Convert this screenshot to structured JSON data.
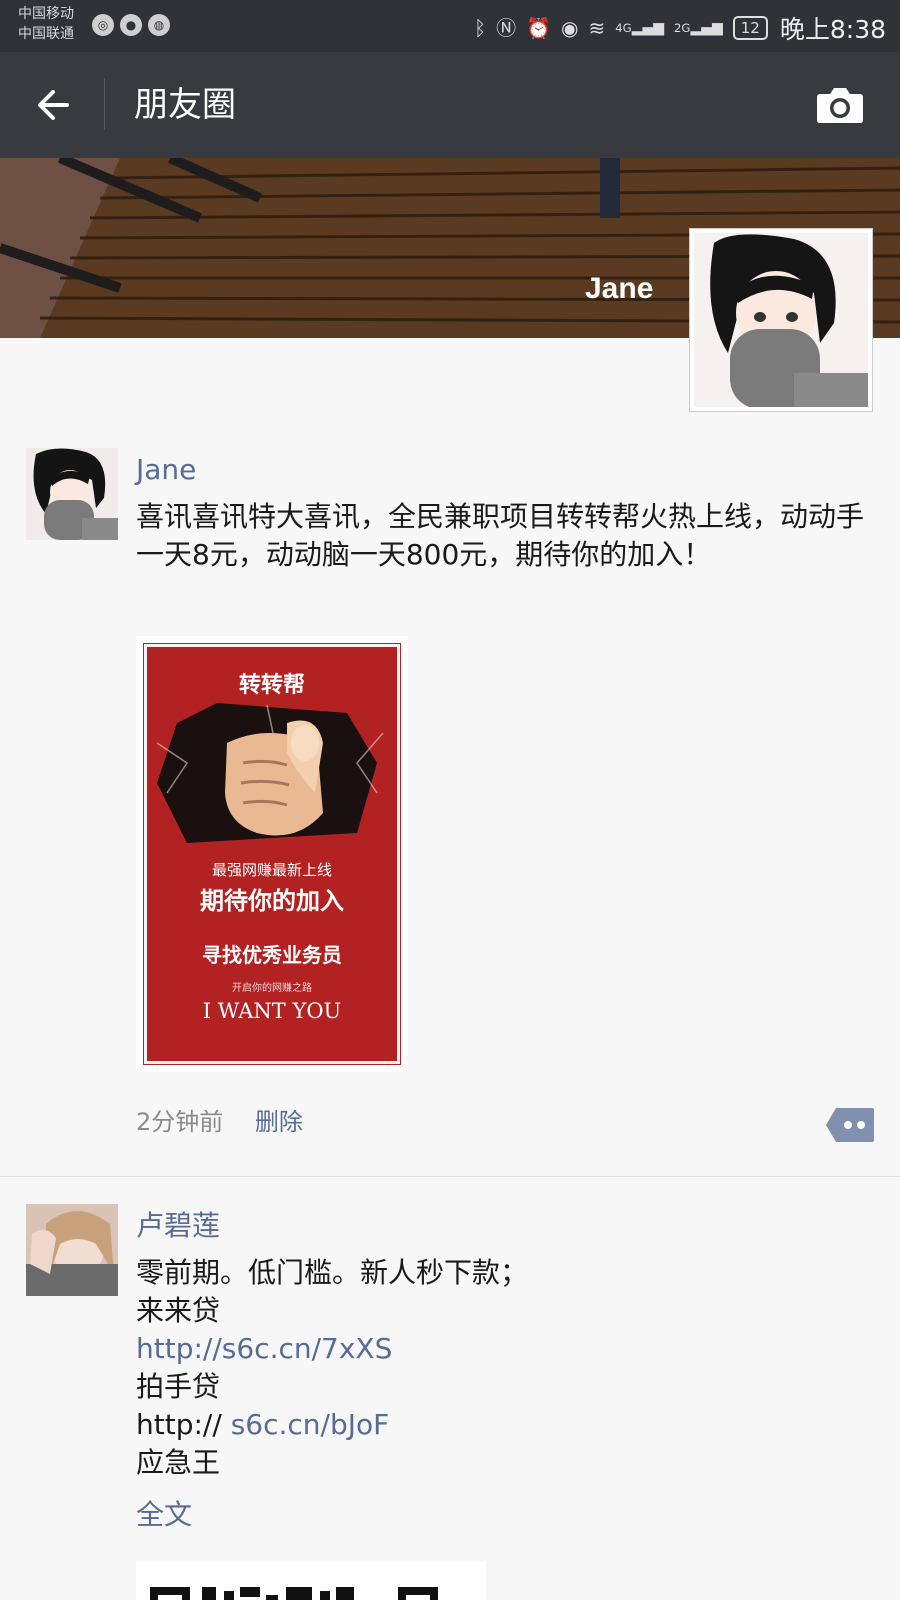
{
  "status_bar": {
    "carrier_1": "中国移动",
    "carrier_2": "中国联通",
    "network_4g": "4G",
    "network_2g": "2G",
    "battery": "12",
    "time": "晚上8:38"
  },
  "nav": {
    "title": "朋友圈",
    "back_icon": "arrow-left-icon",
    "camera_icon": "camera-icon"
  },
  "cover": {
    "name": "Jane"
  },
  "posts": [
    {
      "username": "Jane",
      "text": "喜讯喜讯特大喜讯，全民兼职项目转转帮火热上线，动动手一天8元，动动脑一天800元，期待你的加入！",
      "image": {
        "brand": "转转帮",
        "line1": "最强网赚最新上线",
        "line2": "期待你的加入",
        "line3": "寻找优秀业务员",
        "line4": "开启你的网赚之路",
        "line5": "I WANT YOU"
      },
      "time": "2分钟前",
      "delete_label": "删除"
    },
    {
      "username": "卢碧莲",
      "lines": [
        {
          "text": "零前期。低门槛。新人秒下款；"
        },
        {
          "text": "来来贷"
        },
        {
          "link": "http://s6c.cn/7xXS"
        },
        {
          "text": "拍手贷"
        },
        {
          "prefix": "http:// ",
          "link": "s6c.cn/bJoF"
        },
        {
          "text": "应急王"
        }
      ],
      "full_text_label": "全文"
    }
  ],
  "colors": {
    "link": "#576b95",
    "navbar": "#393a3f",
    "statusbar": "#2f3236",
    "poster_red": "#b32222"
  }
}
